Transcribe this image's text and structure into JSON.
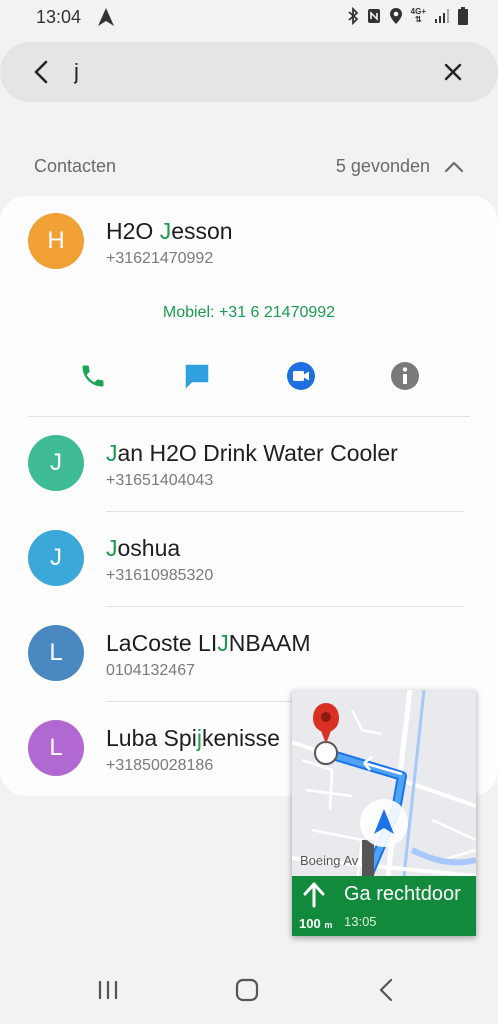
{
  "status": {
    "time": "13:04",
    "network": "4G+"
  },
  "search": {
    "query": "j"
  },
  "section": {
    "title": "Contacten",
    "count": "5 gevonden"
  },
  "contacts": [
    {
      "initial": "H",
      "name_pre": "H2O ",
      "name_hl": "J",
      "name_post": "esson",
      "phone": "+31621470992",
      "color": "#f0a035"
    },
    {
      "initial": "J",
      "name_pre": "",
      "name_hl": "J",
      "name_post": "an H2O Drink Water Cooler",
      "phone": "+31651404043",
      "color": "#3fbb95"
    },
    {
      "initial": "J",
      "name_pre": "",
      "name_hl": "J",
      "name_post": "oshua",
      "phone": "+31610985320",
      "color": "#3aa8d8"
    },
    {
      "initial": "L",
      "name_pre": "LaCoste LI",
      "name_hl": "J",
      "name_post": "NBAAM",
      "phone": "0104132467",
      "color": "#4a88c2"
    },
    {
      "initial": "L",
      "name_pre": "Luba Spi",
      "name_hl": "j",
      "name_post": "kenisse",
      "phone": "+31850028186",
      "color": "#b168d0"
    }
  ],
  "expanded": {
    "mobile_label": "Mobiel: +31 6 21470992",
    "actions": [
      {
        "icon": "phone-icon",
        "color": "#1aa453"
      },
      {
        "icon": "message-icon",
        "color": "#2fa0e0"
      },
      {
        "icon": "video-icon",
        "color": "#1f6fe0"
      },
      {
        "icon": "info-icon",
        "color": "#7a7a7a"
      }
    ]
  },
  "navigation": {
    "road_name": "Boeing Av",
    "instruction": "Ga rechtdoor",
    "distance": "100",
    "distance_unit": "m",
    "eta": "13:05",
    "banner_color": "#118a3b"
  }
}
